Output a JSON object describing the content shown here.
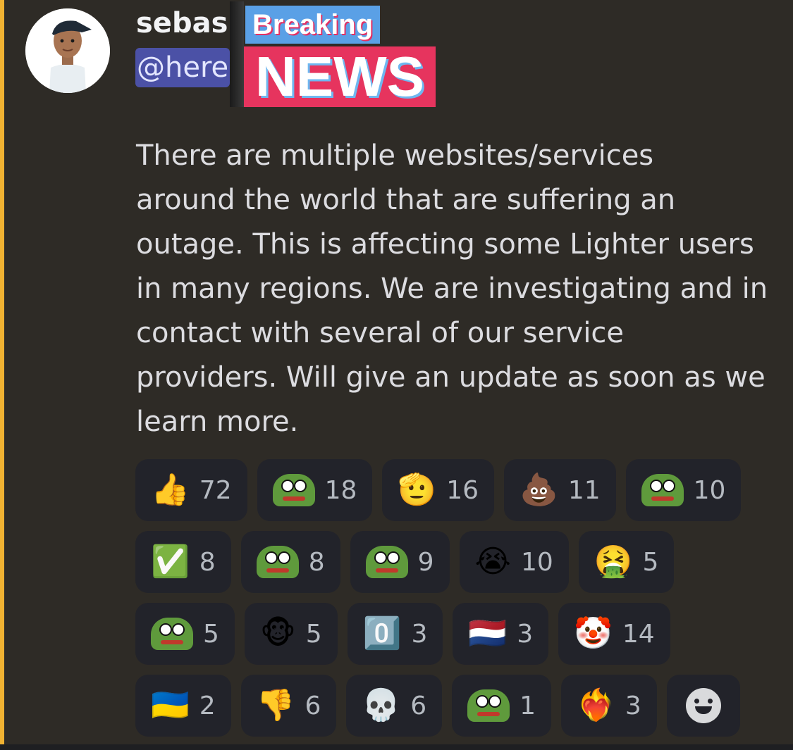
{
  "message": {
    "author": "sebas",
    "mention": "@here",
    "sticker": {
      "top_text": "Breaking",
      "bottom_text": "NEWS"
    },
    "text": "There are multiple websites/services\naround the world that are suffering an\noutage. This is affecting some Lighter users\nin many regions. We are investigating and in\ncontact with several of our service\nproviders. Will give an update as soon as we\nlearn more."
  },
  "colors": {
    "accent_bar": "#f0b232",
    "mention_bg": "#4b51a6",
    "reaction_bg": "#22232a"
  },
  "reactions": [
    [
      {
        "icon": "thumbs-up-icon",
        "emoji": "👍",
        "count": "72"
      },
      {
        "icon": "crying-frog-icon",
        "emoji": "",
        "count": "18"
      },
      {
        "icon": "saluting-face-icon",
        "emoji": "🫡",
        "count": "16"
      },
      {
        "icon": "poop-icon",
        "emoji": "💩",
        "count": "11"
      },
      {
        "icon": "frog-face-icon",
        "emoji": "",
        "count": "10"
      }
    ],
    [
      {
        "icon": "check-mark-icon",
        "emoji": "✅",
        "count": "8"
      },
      {
        "icon": "business-frog-icon",
        "emoji": "",
        "count": "8"
      },
      {
        "icon": "shocked-frog-icon",
        "emoji": "",
        "count": "9"
      },
      {
        "icon": "loudly-crying-face-icon",
        "emoji": "😭",
        "count": "10"
      },
      {
        "icon": "vomiting-face-icon",
        "emoji": "🤮",
        "count": "5"
      }
    ],
    [
      {
        "icon": "happy-frog-icon",
        "emoji": "",
        "count": "5"
      },
      {
        "icon": "monkey-face-icon",
        "emoji": "🐵",
        "count": "5"
      },
      {
        "icon": "keycap-zero-icon",
        "emoji": "0️⃣",
        "count": "3"
      },
      {
        "icon": "netherlands-flag-icon",
        "emoji": "🇳🇱",
        "count": "3"
      },
      {
        "icon": "clown-face-icon",
        "emoji": "🤡",
        "count": "14"
      }
    ],
    [
      {
        "icon": "ukraine-flag-icon",
        "emoji": "🇺🇦",
        "count": "2"
      },
      {
        "icon": "thumbs-down-icon",
        "emoji": "👎",
        "count": "6"
      },
      {
        "icon": "skull-icon",
        "emoji": "💀",
        "count": "6"
      },
      {
        "icon": "screaming-frog-icon",
        "emoji": "",
        "count": "1"
      },
      {
        "icon": "heart-on-fire-icon",
        "emoji": "❤️‍🔥",
        "count": "3"
      }
    ]
  ],
  "add_reaction_icon": "add-reaction-icon"
}
